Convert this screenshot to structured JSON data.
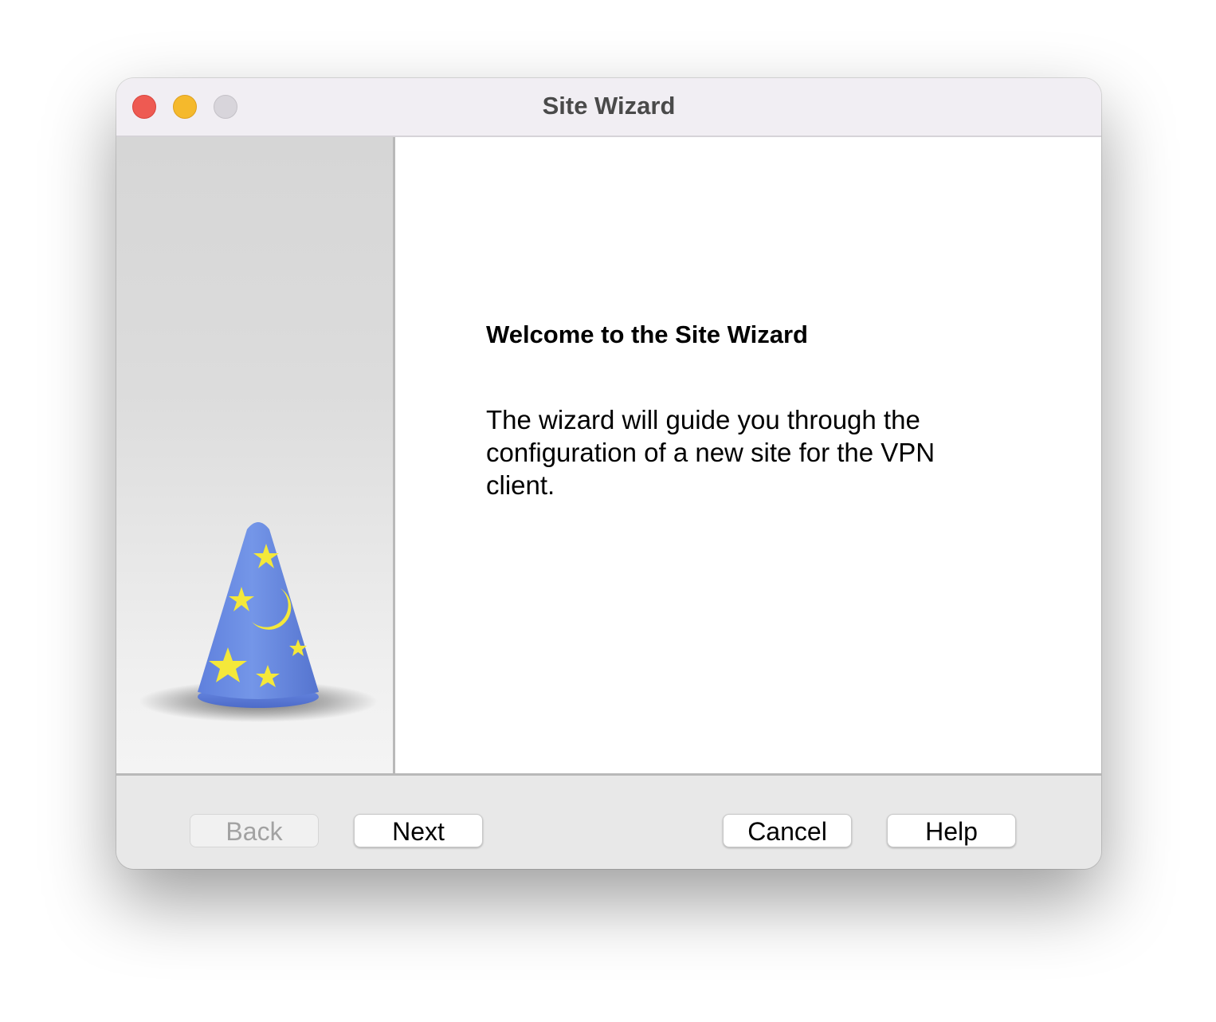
{
  "window": {
    "title": "Site Wizard"
  },
  "content": {
    "heading": "Welcome to the Site Wizard",
    "description": "The wizard will guide you through the configuration of a new site for the VPN client."
  },
  "buttons": {
    "back": "Back",
    "next": "Next",
    "cancel": "Cancel",
    "help": "Help"
  },
  "states": {
    "back_disabled": true
  },
  "icons": {
    "sidebar_art": "wizard-hat-icon"
  },
  "colors": {
    "close": "#ee5a52",
    "minimize": "#f5b92c",
    "maximize_inactive": "#d8d5db",
    "hat_blue": "#6f8ee3",
    "star_yellow": "#f4e83a"
  }
}
